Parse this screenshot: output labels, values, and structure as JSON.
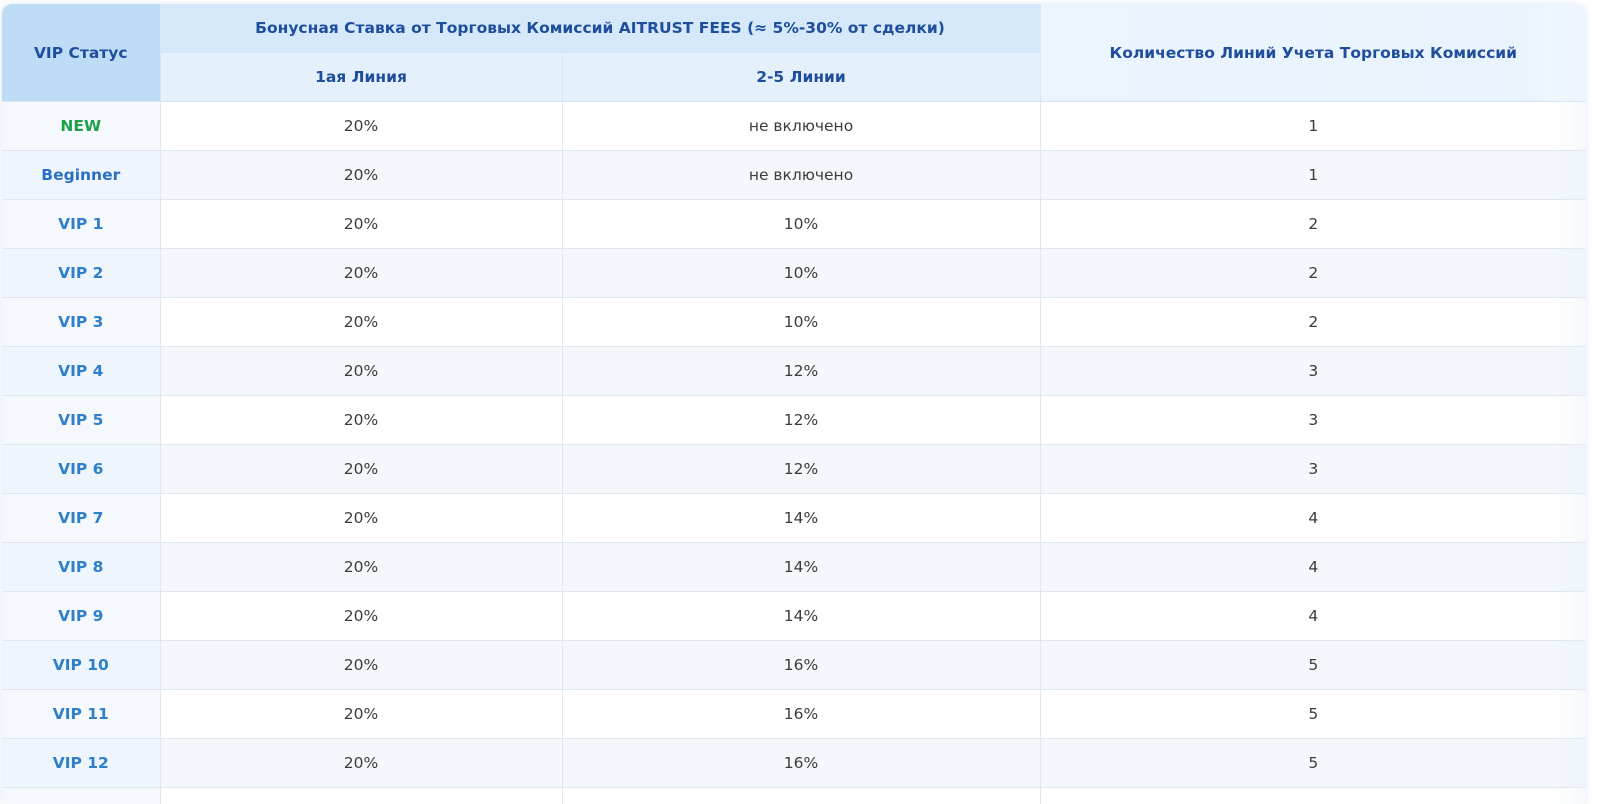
{
  "header": {
    "vip_status": "VIP Статус",
    "bonus_group": "Бонусная Ставка от Торговых Комиссий AITRUST FEES (≈ 5%-30% от сделки)",
    "line1": "1ая Линия",
    "lines2_5": "2-5 Линии",
    "lines_count": "Количество Линий Учета Торговых Комиссий"
  },
  "rows": [
    {
      "status": "NEW",
      "line1": "20%",
      "lines2_5": "не включено",
      "count": "1",
      "status_color": "#1ea04a"
    },
    {
      "status": "Beginner",
      "line1": "20%",
      "lines2_5": "не включено",
      "count": "1",
      "status_color": "#2b6fc4"
    },
    {
      "status": "VIP 1",
      "line1": "20%",
      "lines2_5": "10%",
      "count": "2"
    },
    {
      "status": "VIP 2",
      "line1": "20%",
      "lines2_5": "10%",
      "count": "2"
    },
    {
      "status": "VIP 3",
      "line1": "20%",
      "lines2_5": "10%",
      "count": "2"
    },
    {
      "status": "VIP 4",
      "line1": "20%",
      "lines2_5": "12%",
      "count": "3"
    },
    {
      "status": "VIP 5",
      "line1": "20%",
      "lines2_5": "12%",
      "count": "3"
    },
    {
      "status": "VIP 6",
      "line1": "20%",
      "lines2_5": "12%",
      "count": "3"
    },
    {
      "status": "VIP 7",
      "line1": "20%",
      "lines2_5": "14%",
      "count": "4"
    },
    {
      "status": "VIP 8",
      "line1": "20%",
      "lines2_5": "14%",
      "count": "4"
    },
    {
      "status": "VIP 9",
      "line1": "20%",
      "lines2_5": "14%",
      "count": "4"
    },
    {
      "status": "VIP 10",
      "line1": "20%",
      "lines2_5": "16%",
      "count": "5"
    },
    {
      "status": "VIP 11",
      "line1": "20%",
      "lines2_5": "16%",
      "count": "5"
    },
    {
      "status": "VIP 12",
      "line1": "20%",
      "lines2_5": "16%",
      "count": "5"
    },
    {
      "status": "",
      "line1": "",
      "lines2_5": "",
      "count": ""
    }
  ],
  "colors": {
    "header_text": "#1e4e9c",
    "vip_text": "#2f7fc9",
    "new_text": "#1ea04a",
    "beginner_text": "#2b6fc4"
  }
}
